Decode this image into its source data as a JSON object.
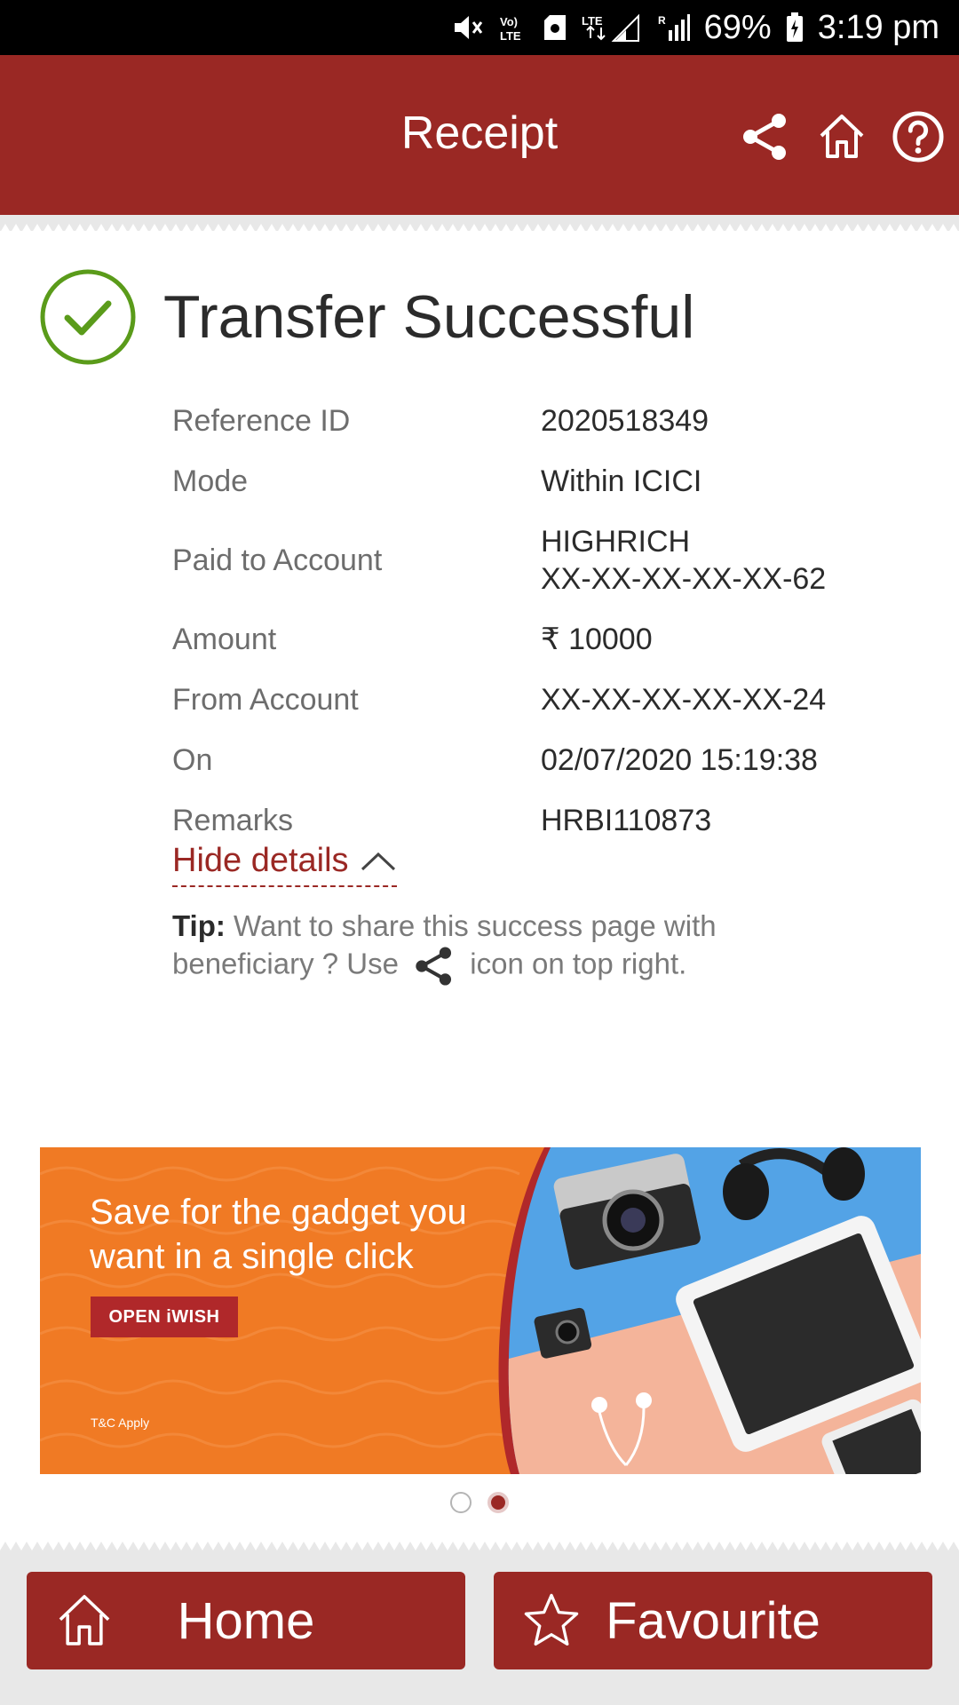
{
  "status_bar": {
    "battery": "69%",
    "time": "3:19 pm"
  },
  "header": {
    "title": "Receipt",
    "icons": [
      "share-icon",
      "home-icon",
      "help-icon"
    ]
  },
  "receipt": {
    "status_title": "Transfer Successful",
    "details": [
      {
        "label": "Reference ID",
        "value": "2020518349"
      },
      {
        "label": "Mode",
        "value": "Within ICICI"
      },
      {
        "label": "Paid to Account",
        "value": "HIGHRICH",
        "value2": "XX-XX-XX-XX-XX-62"
      },
      {
        "label": "Amount",
        "value": "₹ 10000"
      },
      {
        "label": "From Account",
        "value": "XX-XX-XX-XX-XX-24"
      },
      {
        "label": "On",
        "value": "02/07/2020 15:19:38"
      },
      {
        "label": "Remarks",
        "value": "HRBI110873"
      }
    ],
    "hide_details": "Hide details",
    "tip_label": "Tip:",
    "tip_text_1": " Want to share this success page with beneficiary ? Use ",
    "tip_text_2": " icon on top right."
  },
  "banner": {
    "line1": "Save for the gadget you",
    "line2": "want in a single click",
    "button": "OPEN iWISH",
    "tnc": "T&C Apply",
    "page_count": 2,
    "active_page": 2
  },
  "bottom": {
    "home_label": "Home",
    "favourite_label": "Favourite"
  },
  "colors": {
    "brand": "#9a2824",
    "success": "#5a9b1a",
    "banner": "#f07a24"
  }
}
